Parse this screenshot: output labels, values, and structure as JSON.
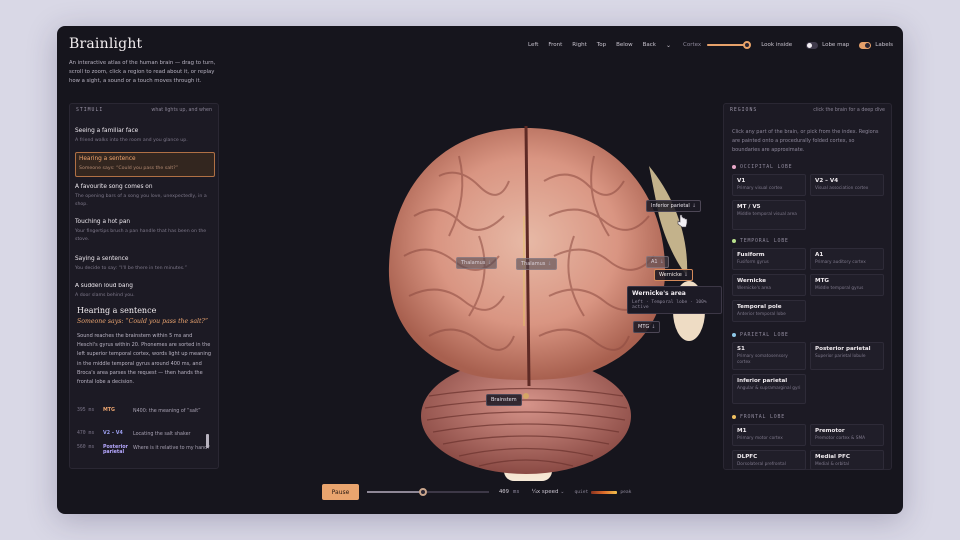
{
  "app": {
    "title": "Brainlight",
    "intro": "An interactive atlas of the human brain — drag to turn, scroll to zoom, click a region to read about it, or replay how a sight, a sound or a touch moves through it."
  },
  "views": [
    "Left",
    "Front",
    "Right",
    "Top",
    "Below",
    "Back"
  ],
  "cortex": {
    "label": "Cortex",
    "value": 0.95
  },
  "look_inside": "Look inside",
  "lobe_map": {
    "label": "Lobe map",
    "on": false
  },
  "labels_toggle": {
    "label": "Labels",
    "on": true
  },
  "stimuli": {
    "title": "STIMULI",
    "hint": "what lights up, and when",
    "items": [
      {
        "title": "Seeing a familiar face",
        "sub": "A friend walks into the room and you glance up."
      },
      {
        "title": "Hearing a sentence",
        "sub": "Someone says: “Could you pass the salt?”",
        "active": true
      },
      {
        "title": "A favourite song comes on",
        "sub": "The opening bars of a song you love, unexpectedly, in a shop."
      },
      {
        "title": "Touching a hot pan",
        "sub": "Your fingertips brush a pan handle that has been on the stove."
      },
      {
        "title": "Saying a sentence",
        "sub": "You decide to say: “I'll be there in ten minutes.”"
      },
      {
        "title": "A sudden loud bang",
        "sub": "A door slams behind you."
      }
    ]
  },
  "detail": {
    "title": "Hearing a sentence",
    "quote": "Someone says: “Could you pass the salt?”",
    "desc": "Sound reaches the brainstem within 5 ms and Heschl's gyrus within 20. Phonemes are sorted in the left superior temporal cortex, words light up meaning in the middle temporal gyrus around 400 ms, and Broca's area parses the request — then hands the frontal lobe a decision."
  },
  "timeline": [
    {
      "ms": "395 ms",
      "region": "MTG",
      "color": "#e9a36f",
      "note": "N400: the meaning of “salt”"
    },
    {
      "ms": "470 ms",
      "region": "V2 – V4",
      "color": "#9c9ff0",
      "note": "Locating the salt shaker"
    },
    {
      "ms": "560 ms",
      "region": "Posterior parietal",
      "color": "#b6a8ff",
      "note": "Where is it relative to my hand?"
    }
  ],
  "regions": {
    "title": "REGIONS",
    "hint": "click the brain for a deep dive",
    "intro": "Click any part of the brain, or pick from the index. Regions are painted onto a procedurally folded cortex, so boundaries are approximate.",
    "groups": [
      {
        "name": "OCCIPITAL LOBE",
        "color": "#e8a8c8",
        "cards": [
          {
            "name": "V1",
            "desc": "Primary visual cortex"
          },
          {
            "name": "V2 – V4",
            "desc": "Visual association cortex"
          },
          {
            "name": "MT / V5",
            "desc": "Middle temporal visual area"
          }
        ]
      },
      {
        "name": "TEMPORAL LOBE",
        "color": "#b8e08c",
        "cards": [
          {
            "name": "Fusiform",
            "desc": "Fusiform gyrus"
          },
          {
            "name": "A1",
            "desc": "Primary auditory cortex"
          },
          {
            "name": "Wernicke",
            "desc": "Wernicke's area"
          },
          {
            "name": "MTG",
            "desc": "Middle temporal gyrus"
          },
          {
            "name": "Temporal pole",
            "desc": "Anterior temporal lobe"
          }
        ]
      },
      {
        "name": "PARIETAL LOBE",
        "color": "#8ec8e8",
        "cards": [
          {
            "name": "S1",
            "desc": "Primary somatosensory cortex"
          },
          {
            "name": "Posterior parietal",
            "desc": "Superior parietal lobule"
          },
          {
            "name": "Inferior parietal",
            "desc": "Angular & supramarginal gyri"
          }
        ]
      },
      {
        "name": "FRONTAL LOBE",
        "color": "#f0c060",
        "cards": [
          {
            "name": "M1",
            "desc": "Primary motor cortex"
          },
          {
            "name": "Premotor",
            "desc": "Premotor cortex & SMA"
          },
          {
            "name": "DLPFC",
            "desc": "Dorsolateral prefrontal"
          },
          {
            "name": "Medial PFC",
            "desc": "Medial & orbital"
          }
        ]
      }
    ]
  },
  "brain_labels": {
    "inferior_parietal": "Inferior parietal",
    "thalamus_left": "Thalamus",
    "thalamus_right": "Thalamus",
    "a1": "A1",
    "wernicke": "Wernicke",
    "mtg": "MTG",
    "brainstem": "Brainstem",
    "arrow": "↓"
  },
  "tooltip": {
    "name": "Wernicke's area",
    "meta": "Left · Temporal lobe · 100% active"
  },
  "player": {
    "pause": "Pause",
    "progress": 0.46,
    "ms": "409",
    "unit": "ms",
    "speed": "¼x speed",
    "quiet": "quiet",
    "peak": "peak"
  }
}
